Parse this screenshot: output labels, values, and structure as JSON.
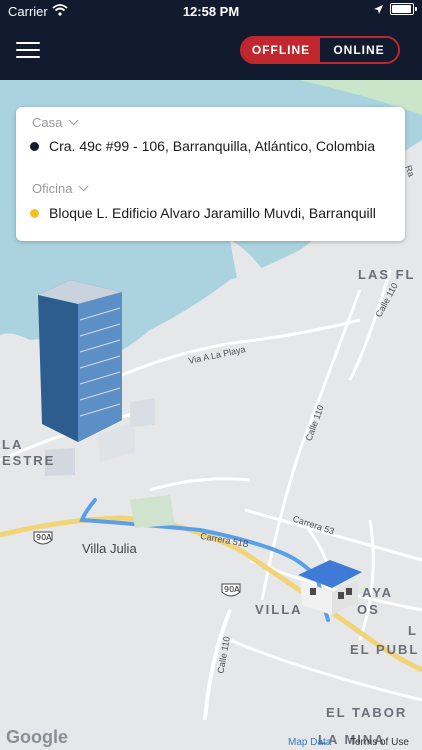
{
  "status_bar": {
    "carrier": "Carrier",
    "time": "12:58 PM",
    "battery_level": 0.95
  },
  "header": {
    "menu_icon": "hamburger-menu-icon",
    "toggle": {
      "offline_label": "OFFLINE",
      "online_label": "ONLINE",
      "selected": "OFFLINE"
    }
  },
  "colors": {
    "header_bg": "#111a2e",
    "accent_red": "#c0282d",
    "home_dot": "#111a2e",
    "work_dot": "#f3c325",
    "route": "#4a90e2",
    "water": "#aad3df"
  },
  "locations": [
    {
      "label": "Casa",
      "address": "Cra. 49c #99 - 106, Barranquilla, Atlántico, Colombia"
    },
    {
      "label": "Oficina",
      "address": "Bloque L. Edificio Alvaro Jaramillo Muvdi, Barranquilla"
    }
  ],
  "map": {
    "area_labels": [
      "LAS FL",
      "LA",
      "ESTRE",
      "Villa Julia",
      "VILLA",
      "AYA",
      "OS",
      "EL PUBL",
      "EL TABOR",
      "LA MINA",
      "L"
    ],
    "street_labels": [
      "Calle 110",
      "Via A La Playa",
      "Calle 110",
      "Carrera 53",
      "Carrera 51B",
      "Calle 110",
      "Ra"
    ],
    "road_shields": [
      "90A",
      "90A"
    ],
    "attribution": {
      "logo": "Google",
      "map_data": "Map Data",
      "terms": "Terms of Use"
    }
  }
}
